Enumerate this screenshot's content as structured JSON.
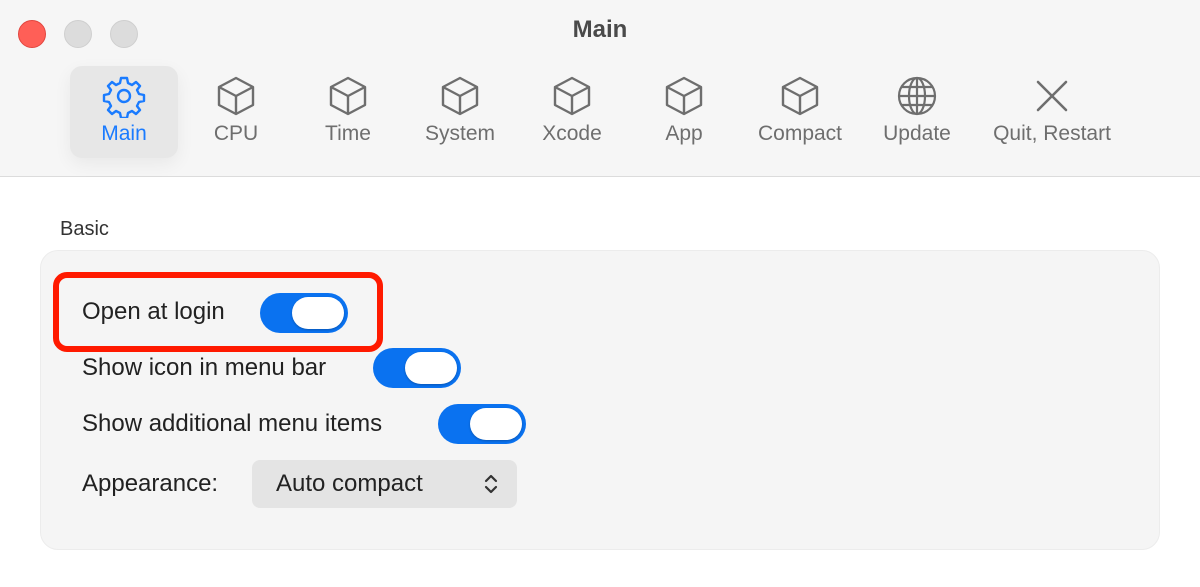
{
  "window": {
    "title": "Main"
  },
  "toolbar": {
    "tabs": [
      {
        "label": "Main",
        "icon": "gear-icon",
        "active": true
      },
      {
        "label": "CPU",
        "icon": "cube-icon",
        "active": false
      },
      {
        "label": "Time",
        "icon": "cube-icon",
        "active": false
      },
      {
        "label": "System",
        "icon": "cube-icon",
        "active": false
      },
      {
        "label": "Xcode",
        "icon": "cube-icon",
        "active": false
      },
      {
        "label": "App",
        "icon": "cube-icon",
        "active": false
      },
      {
        "label": "Compact",
        "icon": "cube-icon",
        "active": false
      },
      {
        "label": "Update",
        "icon": "globe-icon",
        "active": false
      },
      {
        "label": "Quit, Restart",
        "icon": "close-icon",
        "active": false
      }
    ]
  },
  "basic": {
    "section_label": "Basic",
    "open_at_login": {
      "label": "Open at login",
      "on": true
    },
    "show_icon": {
      "label": "Show icon in menu bar",
      "on": true
    },
    "show_additional": {
      "label": "Show additional menu items",
      "on": true
    },
    "appearance": {
      "label": "Appearance:",
      "value": "Auto compact"
    }
  },
  "colors": {
    "accent": "#0a72f0",
    "highlight": "#ff1a00",
    "active_tab": "#1a7bff"
  }
}
